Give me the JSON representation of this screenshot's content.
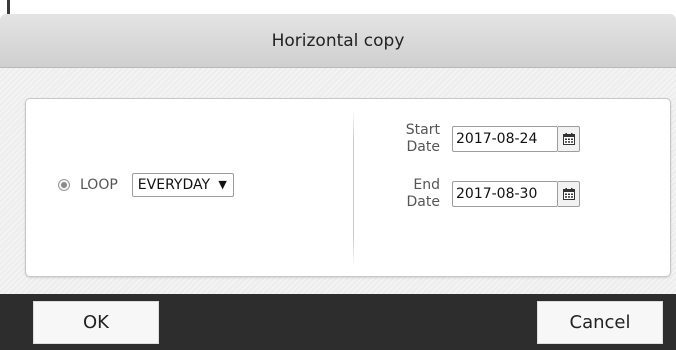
{
  "dialog": {
    "title": "Horizontal copy"
  },
  "loop": {
    "label": "LOOP",
    "selected": true,
    "frequency_value": "EVERYDAY",
    "frequency_arrow": "▼"
  },
  "dates": {
    "start_label_line1": "Start",
    "start_label_line2": "Date",
    "start_value": "2017-08-24",
    "end_label_line1": "End",
    "end_label_line2": "Date",
    "end_value": "2017-08-30"
  },
  "buttons": {
    "ok_label": "OK",
    "cancel_label": "Cancel"
  },
  "icons": {
    "calendar": "calendar-icon",
    "radio": "radio-selected-icon",
    "dropdown": "chevron-down-icon"
  },
  "colors": {
    "titlebar": "#d8d8d8",
    "footer": "#2d2d2d",
    "panel": "#ffffff"
  }
}
